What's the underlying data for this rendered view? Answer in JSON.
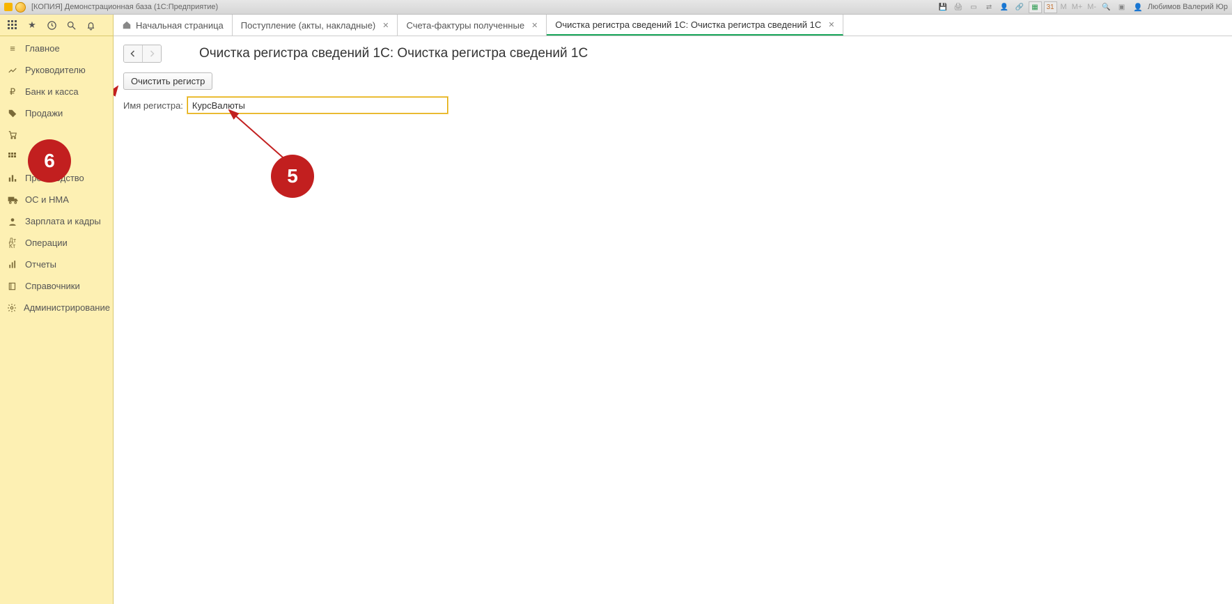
{
  "titlebar": {
    "title": "[КОПИЯ] Демонстрационная база  (1С:Предприятие)",
    "user": "Любимов Валерий Юр",
    "m_buttons": [
      "M",
      "M+",
      "M-"
    ]
  },
  "sidebar": {
    "items": [
      {
        "icon": "menu",
        "label": "Главное"
      },
      {
        "icon": "chart",
        "label": "Руководителю"
      },
      {
        "icon": "ruble",
        "label": "Банк и касса"
      },
      {
        "icon": "tag",
        "label": "Продажи"
      },
      {
        "icon": "cart",
        "label": ""
      },
      {
        "icon": "grid",
        "label": ""
      },
      {
        "icon": "bars",
        "label": "Производство"
      },
      {
        "icon": "truck",
        "label": "ОС и НМА"
      },
      {
        "icon": "person",
        "label": "Зарплата и кадры"
      },
      {
        "icon": "dk",
        "label": "Операции"
      },
      {
        "icon": "stats",
        "label": "Отчеты"
      },
      {
        "icon": "book",
        "label": "Справочники"
      },
      {
        "icon": "gear",
        "label": "Администрирование"
      }
    ]
  },
  "tabs": [
    {
      "label": "Начальная страница",
      "home": true,
      "closable": false
    },
    {
      "label": "Поступление (акты, накладные)",
      "closable": true
    },
    {
      "label": "Счета-фактуры полученные",
      "closable": true
    },
    {
      "label": "Очистка регистра сведений 1С: Очистка регистра сведений 1С",
      "closable": true,
      "active": true
    }
  ],
  "page": {
    "title": "Очистка регистра сведений 1С: Очистка регистра сведений 1С",
    "clear_button": "Очистить регистр",
    "field_label": "Имя регистра:",
    "field_value": "КурсВалюты"
  },
  "annotations": {
    "callout5": "5",
    "callout6": "6"
  }
}
